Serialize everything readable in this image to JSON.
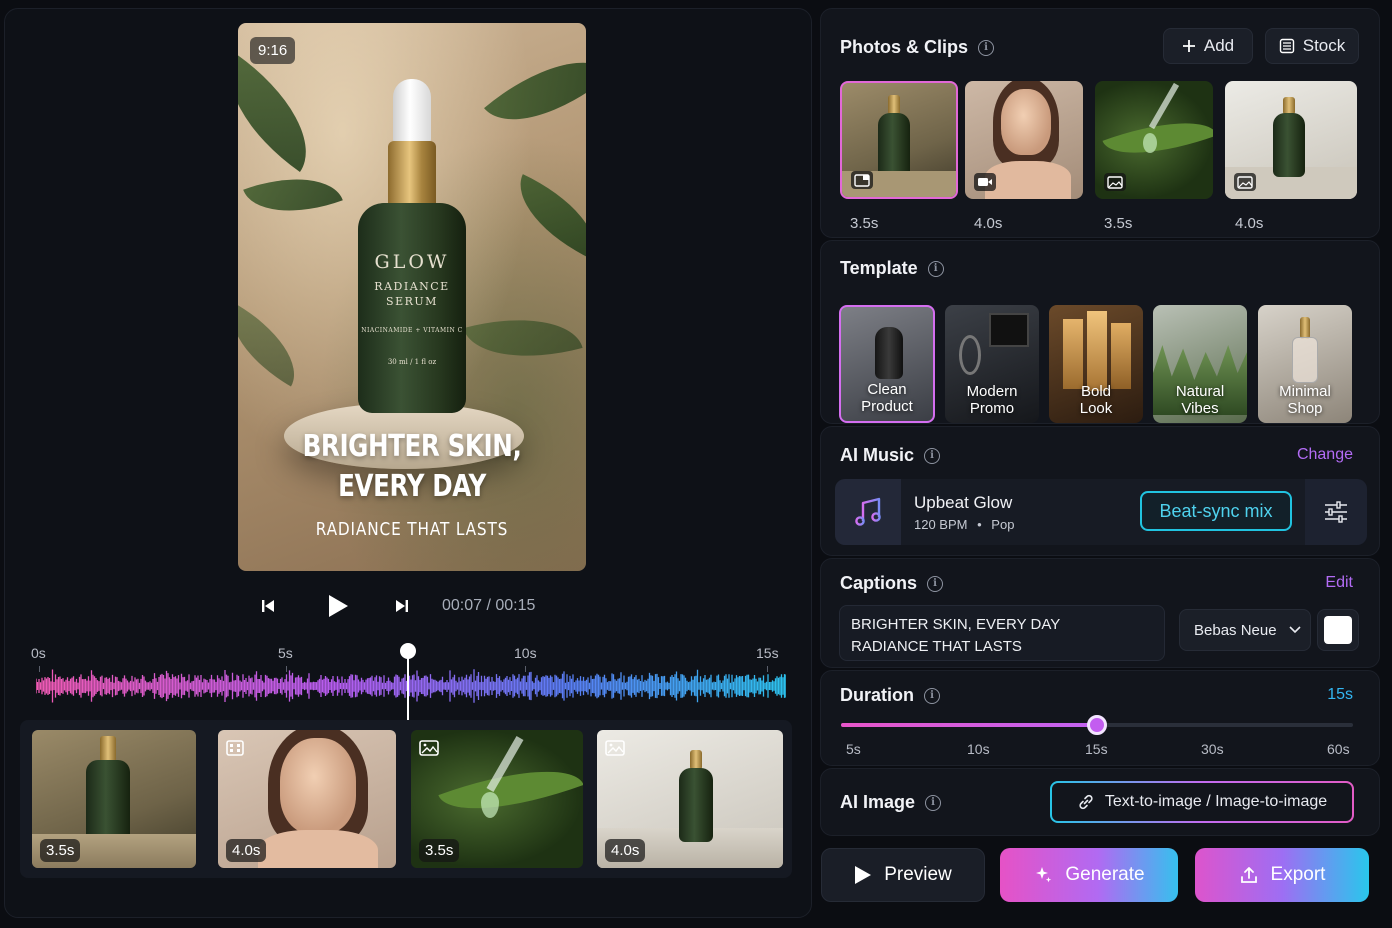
{
  "preview": {
    "ratio": "9:16",
    "bottle_brand": "GLOW",
    "bottle_line1": "RADIANCE",
    "bottle_line2": "SERUM",
    "bottle_ingredients": "NIACINAMIDE + VITAMIN C",
    "bottle_size": "30 ml / 1 fl oz",
    "caption_line1": "BRIGHTER SKIN,",
    "caption_line2": "EVERY DAY",
    "caption_line3": "RADIANCE THAT LASTS"
  },
  "playback": {
    "time": "00:07 / 00:15",
    "progress": 0.4667
  },
  "timeline": {
    "ruler": [
      "0s",
      "5s",
      "10s",
      "15s"
    ],
    "clips": [
      {
        "duration": "3.5s",
        "kind": "photo"
      },
      {
        "duration": "4.0s",
        "kind": "video"
      },
      {
        "duration": "3.5s",
        "kind": "photo"
      },
      {
        "duration": "4.0s",
        "kind": "photo"
      }
    ]
  },
  "photos": {
    "title": "Photos & Clips",
    "add_label": "Add",
    "stock_label": "Stock",
    "items": [
      {
        "duration": "3.5s",
        "icon": "image-icon",
        "selected": true
      },
      {
        "duration": "4.0s",
        "icon": "video-icon",
        "selected": false
      },
      {
        "duration": "3.5s",
        "icon": "image-icon",
        "selected": false
      },
      {
        "duration": "4.0s",
        "icon": "image-icon",
        "selected": false
      }
    ]
  },
  "template": {
    "title": "Template",
    "items": [
      {
        "line1": "Clean",
        "line2": "Product",
        "selected": true
      },
      {
        "line1": "Modern",
        "line2": "Promo",
        "selected": false
      },
      {
        "line1": "Bold",
        "line2": "Look",
        "selected": false
      },
      {
        "line1": "Natural",
        "line2": "Vibes",
        "selected": false
      },
      {
        "line1": "Minimal",
        "line2": "Shop",
        "selected": false
      }
    ]
  },
  "music": {
    "title": "AI Music",
    "change_label": "Change",
    "track_name": "Upbeat Glow",
    "bpm": "120 BPM",
    "separator": "•",
    "genre": "Pop",
    "beat_sync_label": "Beat-sync mix"
  },
  "captions": {
    "title": "Captions",
    "edit_label": "Edit",
    "line1": "BRIGHTER SKIN, EVERY DAY",
    "line2": "RADIANCE THAT LASTS",
    "font": "Bebas Neue",
    "color": "#ffffff"
  },
  "duration": {
    "title": "Duration",
    "value_label": "15s",
    "options": [
      "5s",
      "10s",
      "15s",
      "30s",
      "60s"
    ],
    "selected_index": 2
  },
  "ai_image": {
    "title": "AI Image",
    "button_label": "Text-to-image / Image-to-image"
  },
  "actions": {
    "preview_label": "Preview",
    "generate_label": "Generate",
    "export_label": "Export"
  },
  "colors": {
    "accent_pink": "#e268d8",
    "accent_purple": "#b36cf5",
    "accent_cyan": "#33b6f2",
    "panel": "#12151c",
    "background": "#0b0d12"
  }
}
